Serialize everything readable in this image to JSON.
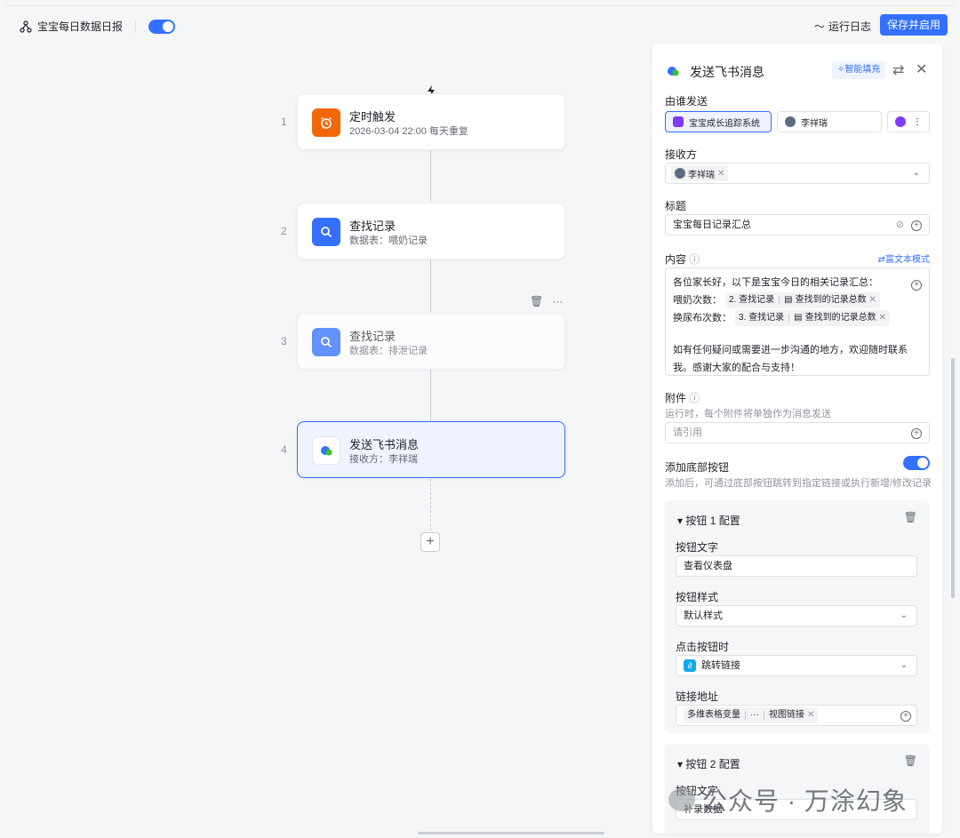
{
  "header": {
    "flow_name": "宝宝每日数据日报",
    "run_log": "运行日志",
    "save_enable": "保存并启用"
  },
  "nodes": [
    {
      "num": "1",
      "title": "定时触发",
      "sub": "2026-03-04 22:00 每天重复",
      "icon": "alarm-clock-icon",
      "color": "#f1680a"
    },
    {
      "num": "2",
      "title": "查找记录",
      "sub": "数据表：喂奶记录",
      "icon": "search-icon",
      "color": "#3370ff"
    },
    {
      "num": "3",
      "title": "查找记录",
      "sub": "数据表：排泄记录",
      "icon": "search-icon",
      "color": "#3370ff"
    },
    {
      "num": "4",
      "title": "发送飞书消息",
      "sub": "接收方：李祥瑞",
      "icon": "feishu-message-icon"
    }
  ],
  "panel": {
    "title": "发送飞书消息",
    "smart_fill": "✧智能填充",
    "sender_label": "由谁发送",
    "sender_options": [
      "宝宝成长追踪系统",
      "李祥瑞"
    ],
    "receiver_label": "接收方",
    "receiver_chip": "李祥瑞",
    "subject_label": "标题",
    "subject_value": "宝宝每日记录汇总",
    "content_label": "内容",
    "rich_text_mode": "⇄富文本模式",
    "content": {
      "line1": "各位家长好，以下是宝宝今日的相关记录汇总：",
      "line2_prefix": "喂奶次数：",
      "line2_step": "2. 查找记录",
      "line2_field": "查找到的记录总数",
      "line3_prefix": "换尿布次数：",
      "line3_step": "3. 查找记录",
      "line3_field": "查找到的记录总数",
      "line4": "如有任何疑问或需要进一步沟通的地方，欢迎随时联系",
      "line5": "我。感谢大家的配合与支持！"
    },
    "attachment_label": "附件",
    "attachment_hint": "运行时，每个附件将单独作为消息发送",
    "attachment_placeholder": "请引用",
    "bottom_button_label": "添加底部按钮",
    "bottom_button_hint": "添加后，可通过底部按钮跳转到指定链接或执行新增/修改记录",
    "button1": {
      "header": "按钮 1 配置",
      "text_label": "按钮文字",
      "text_value": "查看仪表盘",
      "style_label": "按钮样式",
      "style_value": "默认样式",
      "click_label": "点击按钮时",
      "click_value": "跳转链接",
      "url_label": "链接地址",
      "url_chip_a": "多维表格变量",
      "url_chip_b": "视图链接"
    },
    "button2": {
      "header": "按钮 2 配置",
      "text_label": "按钮文字",
      "text_value": "补录数据"
    }
  },
  "watermark": "公众号 · 万涂幻象",
  "colors": {
    "accent": "#3370ff",
    "trigger": "#f1680a"
  }
}
